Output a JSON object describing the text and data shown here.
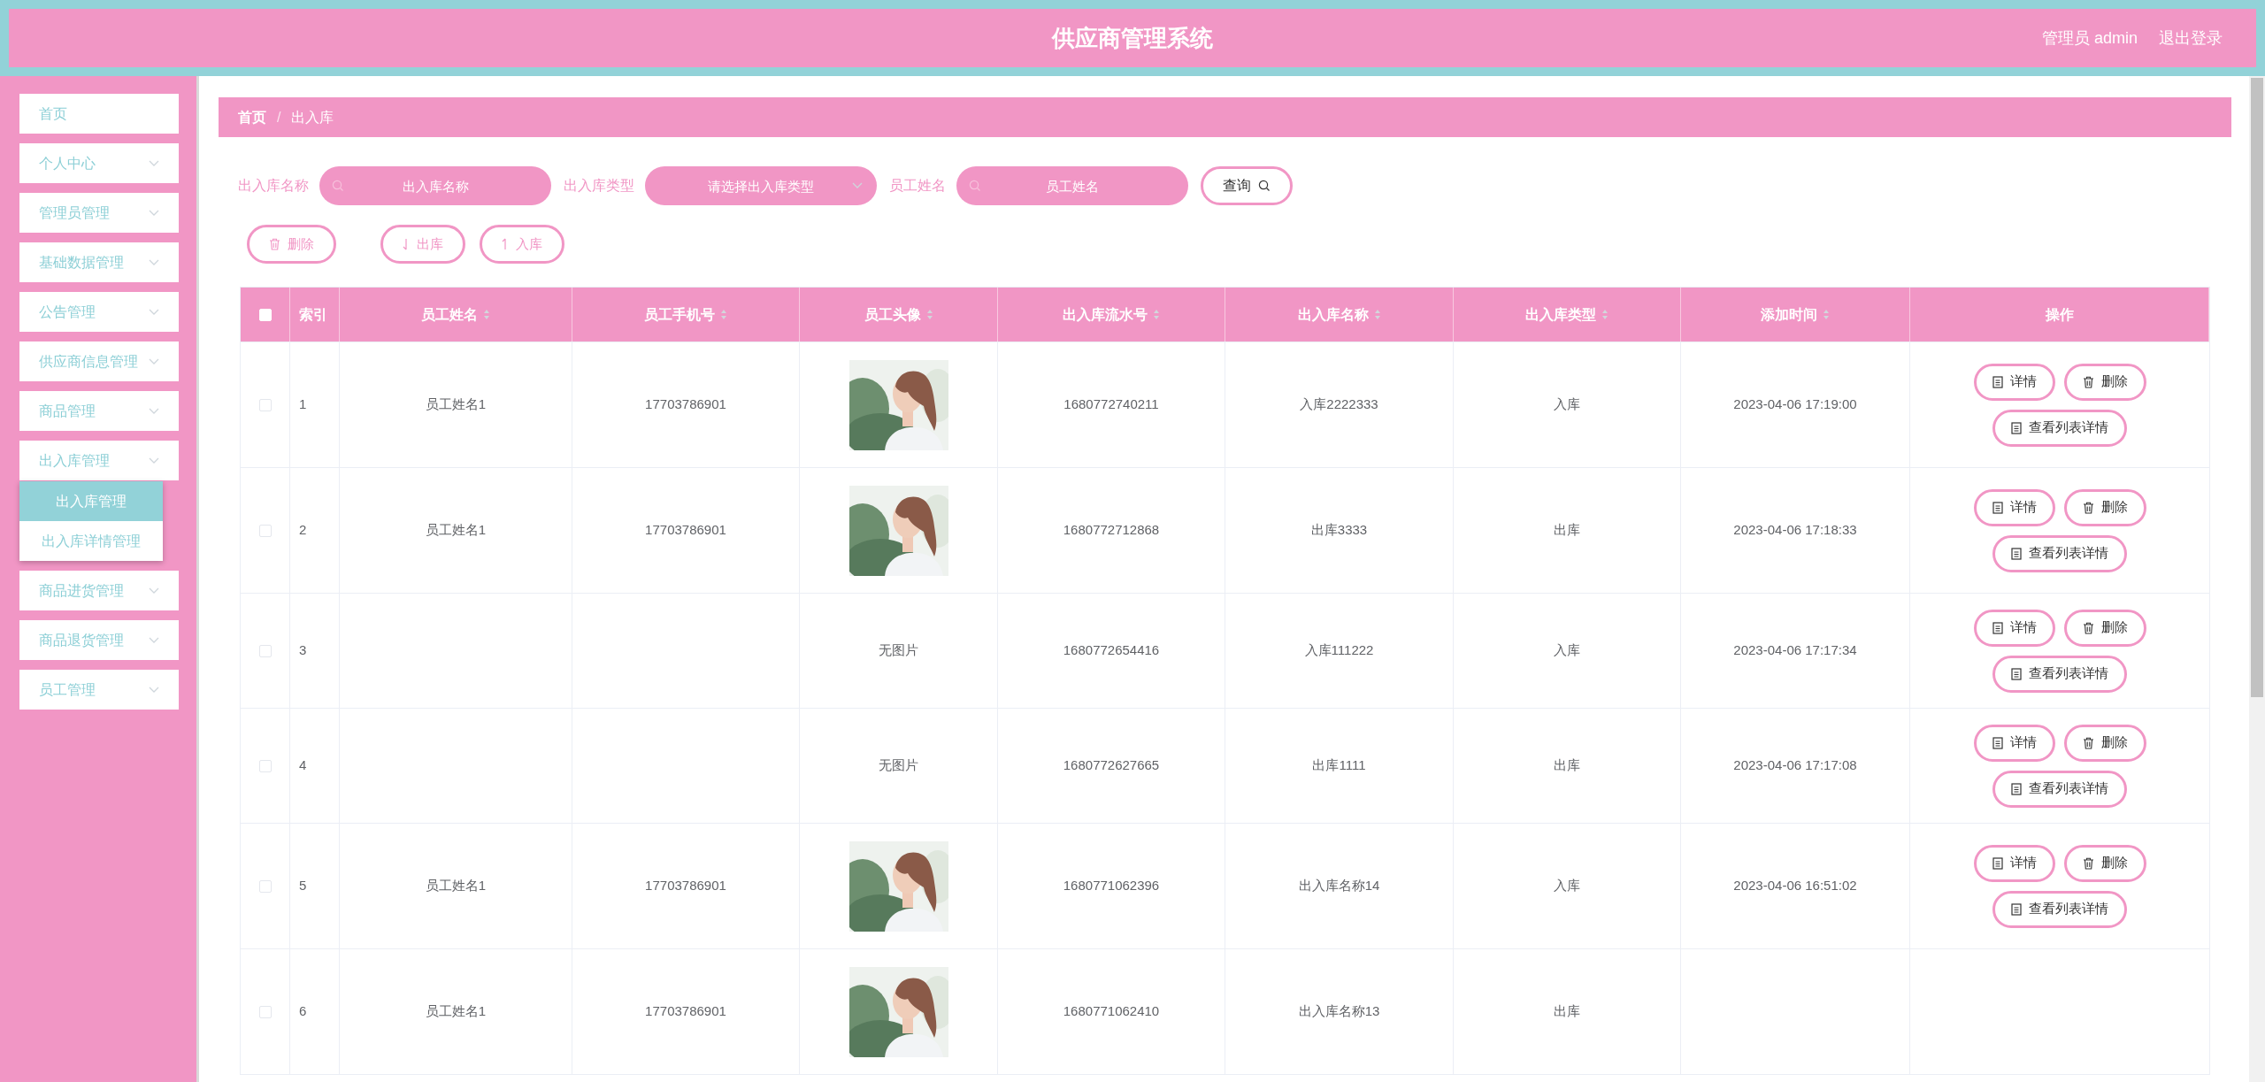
{
  "header": {
    "title": "供应商管理系统",
    "user": "管理员 admin",
    "logout": "退出登录"
  },
  "sidebar": {
    "items": [
      {
        "label": "首页",
        "expandable": false
      },
      {
        "label": "个人中心",
        "expandable": true
      },
      {
        "label": "管理员管理",
        "expandable": true
      },
      {
        "label": "基础数据管理",
        "expandable": true
      },
      {
        "label": "公告管理",
        "expandable": true
      },
      {
        "label": "供应商信息管理",
        "expandable": true
      },
      {
        "label": "商品管理",
        "expandable": true
      },
      {
        "label": "出入库管理",
        "expandable": true,
        "expanded": true,
        "children": [
          {
            "label": "出入库管理",
            "selected": true
          },
          {
            "label": "出入库详情管理",
            "selected": false
          }
        ]
      },
      {
        "label": "商品进货管理",
        "expandable": true
      },
      {
        "label": "商品退货管理",
        "expandable": true
      },
      {
        "label": "员工管理",
        "expandable": true
      }
    ]
  },
  "breadcrumb": {
    "items": [
      "首页",
      "出入库"
    ],
    "separator": "/"
  },
  "search": {
    "fields": [
      {
        "label": "出入库名称",
        "kind": "text",
        "placeholder": "出入库名称"
      },
      {
        "label": "出入库类型",
        "kind": "select",
        "placeholder": "请选择出入库类型"
      },
      {
        "label": "员工姓名",
        "kind": "text",
        "placeholder": "员工姓名"
      }
    ],
    "button": "查询"
  },
  "actions": [
    {
      "label": "删除",
      "kind": "delete"
    },
    {
      "label": "出库",
      "kind": "out"
    },
    {
      "label": "入库",
      "kind": "in"
    }
  ],
  "table": {
    "header_checked": false,
    "columns": [
      {
        "label": "索引",
        "sortable": false
      },
      {
        "label": "员工姓名",
        "sortable": true
      },
      {
        "label": "员工手机号",
        "sortable": true
      },
      {
        "label": "员工头像",
        "sortable": true
      },
      {
        "label": "出入库流水号",
        "sortable": true
      },
      {
        "label": "出入库名称",
        "sortable": true
      },
      {
        "label": "出入库类型",
        "sortable": true
      },
      {
        "label": "添加时间",
        "sortable": true
      },
      {
        "label": "操作",
        "sortable": false
      }
    ],
    "rows": [
      {
        "checked": false,
        "index": "1",
        "name": "员工姓名1",
        "phone": "17703786901",
        "serial": "1680772740211",
        "title": "入库2222333",
        "type": "入库",
        "time": "2023-04-06 17:19:00",
        "actions": [
          {
            "label": "详情",
            "kind": "detail"
          },
          {
            "label": "删除",
            "kind": "delete"
          },
          {
            "label": "查看列表详情",
            "kind": "detail"
          }
        ]
      },
      {
        "checked": false,
        "index": "2",
        "name": "员工姓名1",
        "phone": "17703786901",
        "serial": "1680772712868",
        "title": "出库3333",
        "type": "出库",
        "time": "2023-04-06 17:18:33",
        "actions": [
          {
            "label": "详情",
            "kind": "detail"
          },
          {
            "label": "删除",
            "kind": "delete"
          },
          {
            "label": "查看列表详情",
            "kind": "detail"
          }
        ]
      },
      {
        "checked": false,
        "index": "3",
        "avatar": {
          "kind": "text",
          "text": "无图片"
        },
        "serial": "1680772654416",
        "title": "入库111222",
        "type": "入库",
        "time": "2023-04-06 17:17:34",
        "actions": [
          {
            "label": "详情",
            "kind": "detail"
          },
          {
            "label": "删除",
            "kind": "delete"
          },
          {
            "label": "查看列表详情",
            "kind": "detail"
          }
        ]
      },
      {
        "checked": false,
        "index": "4",
        "avatar": {
          "kind": "text",
          "text": "无图片"
        },
        "serial": "1680772627665",
        "title": "出库1111",
        "type": "出库",
        "time": "2023-04-06 17:17:08",
        "actions": [
          {
            "label": "详情",
            "kind": "detail"
          },
          {
            "label": "删除",
            "kind": "delete"
          },
          {
            "label": "查看列表详情",
            "kind": "detail"
          }
        ]
      },
      {
        "checked": false,
        "index": "5",
        "name": "员工姓名1",
        "phone": "17703786901",
        "serial": "1680771062396",
        "title": "出入库名称14",
        "type": "入库",
        "time": "2023-04-06 16:51:02",
        "actions": [
          {
            "label": "详情",
            "kind": "detail"
          },
          {
            "label": "删除",
            "kind": "delete"
          },
          {
            "label": "查看列表详情",
            "kind": "detail"
          }
        ]
      },
      {
        "checked": false,
        "index": "6",
        "name": "员工姓名1",
        "phone": "17703786901",
        "serial": "1680771062410",
        "title": "出入库名称13",
        "type": "出库"
      }
    ]
  }
}
